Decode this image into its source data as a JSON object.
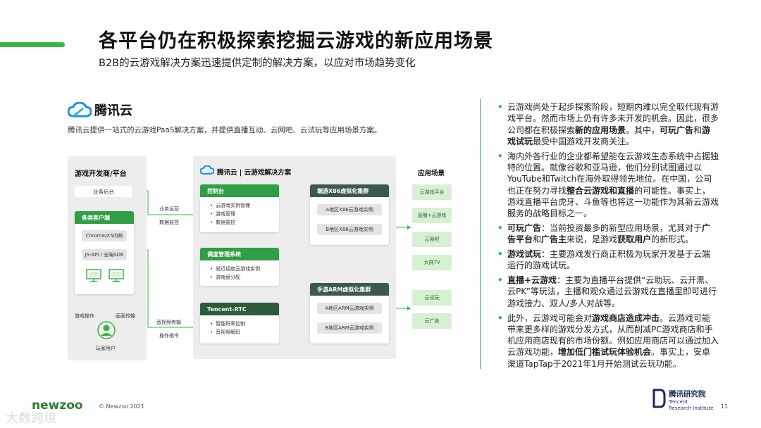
{
  "header": {
    "title": "各平台仍在积极探索挖掘云游戏的新应用场景",
    "subtitle": "B2B的云游戏解决方案迅速提供定制的解决方案，以应对市场趋势变化"
  },
  "diagram": {
    "logo_text": "腾讯云",
    "intro": "腾讯云提供一站式的云游戏PaaS解决方案，并提供直播互动、云网吧、云试玩等应用场景方案。",
    "left_panel": {
      "title": "游戏开发商/平台",
      "backend": "业务后台",
      "clients_title": "各类客户端",
      "client_items": [
        "Chrome/X5内核",
        "JS-API / 全端SDK"
      ],
      "player": "玩家用户",
      "game_op": "游戏操作",
      "video_tx": "画面传输"
    },
    "mid_panel": {
      "title": "腾讯云 | 云游戏解决方案",
      "console": {
        "title": "控制台",
        "items": [
          "云游戏实例管理",
          "游戏管理",
          "数据监控"
        ]
      },
      "scheduler": {
        "title": "调度管理系统",
        "items": [
          "就近调度云游戏实例",
          "游戏盘分配"
        ]
      },
      "rtc": {
        "title": "Tencent-RTC",
        "items": [
          "智能码率控制",
          "音视频解码"
        ]
      },
      "x86": {
        "title": "端游X86虚拟化集群",
        "items": [
          "A地区X86云游戏实例",
          "B地区X86云游戏实例"
        ]
      },
      "arm": {
        "title": "手游ARM虚拟化集群",
        "items": [
          "A地区ARM云游戏实例",
          "B地区ARM云游戏实例"
        ]
      }
    },
    "flow_labels": {
      "ops": "业务运营",
      "data": "数据监控",
      "av": "音视频传输",
      "cmd": "操作指令"
    },
    "scenarios": {
      "title": "应用场景",
      "items": [
        "云游戏平台",
        "直播+云游戏",
        "云网吧",
        "大屏TV",
        "云试玩",
        "云广告"
      ]
    }
  },
  "notes": [
    {
      "parts": [
        {
          "t": "云游戏尚处于起步探索阶段，短期内难以完全取代现有游戏平台。然而市场上仍有许多未开发的机会。因此，很多公司都在积极探索",
          "b": false
        },
        {
          "t": "新的应用场景",
          "b": true
        },
        {
          "t": "。其中，",
          "b": false
        },
        {
          "t": "可玩广告",
          "b": true
        },
        {
          "t": "和",
          "b": false
        },
        {
          "t": "游戏试玩",
          "b": true
        },
        {
          "t": "最受中国游戏开发商关注。",
          "b": false
        }
      ]
    },
    {
      "parts": [
        {
          "t": "海内外各行业的企业都希望能在云游戏生态系统中占据独特的位置。就像谷歌和亚马逊，他们分别试图通过以YouTube和Twitch在海外取得领先地位。在中国，公司也正在努力寻找",
          "b": false
        },
        {
          "t": "整合云游戏和直播",
          "b": true
        },
        {
          "t": "的可能性。事实上，游戏直播平台虎牙、斗鱼等也将这一功能作为其新云游戏服务的战略目标之一。",
          "b": false
        }
      ]
    },
    {
      "parts": [
        {
          "t": "可玩广告",
          "b": true
        },
        {
          "t": "：当前投资最多的新型应用场景，尤其对于",
          "b": false
        },
        {
          "t": "广告平台",
          "b": true
        },
        {
          "t": "和",
          "b": false
        },
        {
          "t": "广告主",
          "b": true
        },
        {
          "t": "来说，是游戏",
          "b": false
        },
        {
          "t": "获取用户",
          "b": true
        },
        {
          "t": "的新形式。",
          "b": false
        }
      ]
    },
    {
      "parts": [
        {
          "t": "游戏试玩",
          "b": true
        },
        {
          "t": "：主要游戏发行商正积极为玩家开发基于云端运行的游戏试玩。",
          "b": false
        }
      ]
    },
    {
      "parts": [
        {
          "t": "直播+云游戏",
          "b": true
        },
        {
          "t": "：主要为直播平台提供“云助玩、云开黑、云PK”等玩法，主播和观众通过云游戏在直播里即可进行游戏接力、双人/多人对战等。",
          "b": false
        }
      ]
    },
    {
      "parts": [
        {
          "t": "此外，云游戏可能会对",
          "b": false
        },
        {
          "t": "游戏商店造成冲击",
          "b": true
        },
        {
          "t": "。云游戏可能带来更多样的游戏分发方式，从而削减PC游戏商店和手机应用商店现有的市场份额。例如应用商店可以通过加入云游戏功能，",
          "b": false
        },
        {
          "t": "增加低门槛试玩体验机会",
          "b": true
        },
        {
          "t": "。事实上，安卓渠道TapTap于2021年1月开始测试云玩功能。",
          "b": false
        }
      ]
    }
  ],
  "footer": {
    "brand": "newzoo",
    "copyright": "© Newzoo 2021",
    "watermark": "大数跨境",
    "research_cn": "腾讯研究院",
    "research_en_1": "Tencent",
    "research_en_2": "Research Institute",
    "page": "11"
  },
  "colors": {
    "accent": "#3ab449",
    "card_green": "#2f9e44",
    "card_dark": "#2c5a3c",
    "scenario_bg": "#d7efd3",
    "panel_bg": "#ededed",
    "tencent_blue": "#1a93e3"
  }
}
